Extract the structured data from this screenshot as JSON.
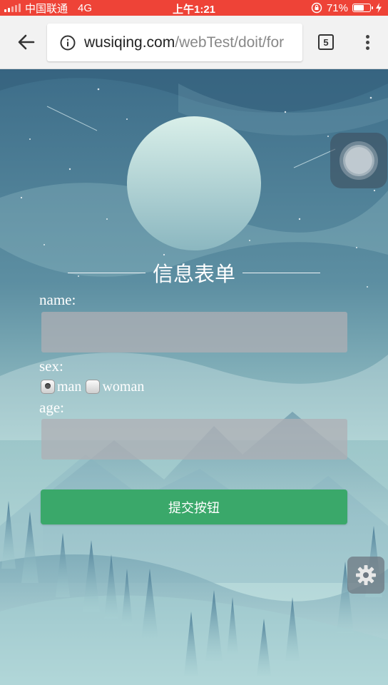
{
  "status_bar": {
    "carrier": "中国联通",
    "network": "4G",
    "time": "上午1:21",
    "battery": "71%",
    "battery_level": 0.71
  },
  "browser": {
    "url_domain": "wusiqing.com",
    "url_path": "/webTest/doit/for",
    "tab_count": "5"
  },
  "form": {
    "title": "信息表单",
    "name_label": "name:",
    "name_value": "",
    "sex_label": "sex:",
    "sex_options": [
      {
        "label": "man",
        "selected": true
      },
      {
        "label": "woman",
        "selected": false
      }
    ],
    "age_label": "age:",
    "age_value": "",
    "submit_label": "提交按钮"
  },
  "colors": {
    "status_bar": "#ee4337",
    "submit_button": "#3aa86a",
    "sky_top": "#3d6d89",
    "sky_bottom": "#c6e4e4"
  },
  "icons": [
    "back-arrow-icon",
    "info-icon",
    "menu-icon",
    "gear-icon",
    "assistive-touch-icon"
  ]
}
